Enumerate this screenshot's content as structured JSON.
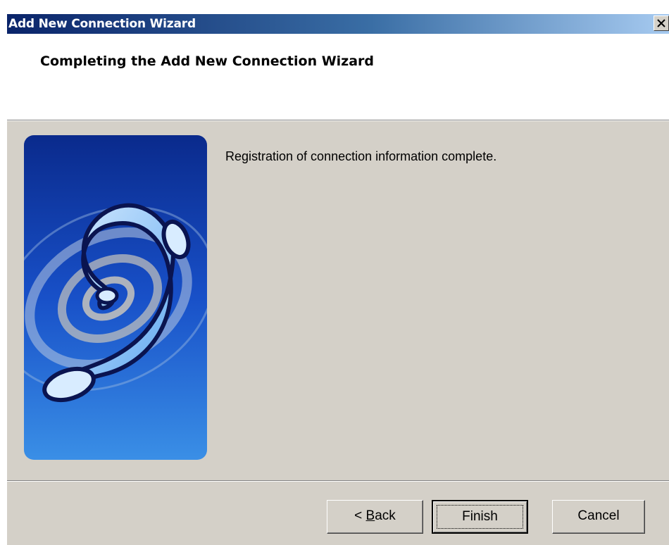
{
  "window": {
    "title": "Add New Connection Wizard",
    "close_icon": "close-icon"
  },
  "header": {
    "title": "Completing the Add New Connection Wizard"
  },
  "body": {
    "illustration": "telephone-handset-icon",
    "message": "Registration of connection information complete."
  },
  "buttons": {
    "back_prefix": "< ",
    "back_mnemonic": "B",
    "back_rest": "ack",
    "finish": "Finish",
    "cancel": "Cancel"
  },
  "colors": {
    "titlebar_start": "#0a246a",
    "titlebar_end": "#a6caf0",
    "dialog_face": "#d4d0c8",
    "art_top": "#0a2a8c",
    "art_bottom": "#3a8fe6"
  }
}
